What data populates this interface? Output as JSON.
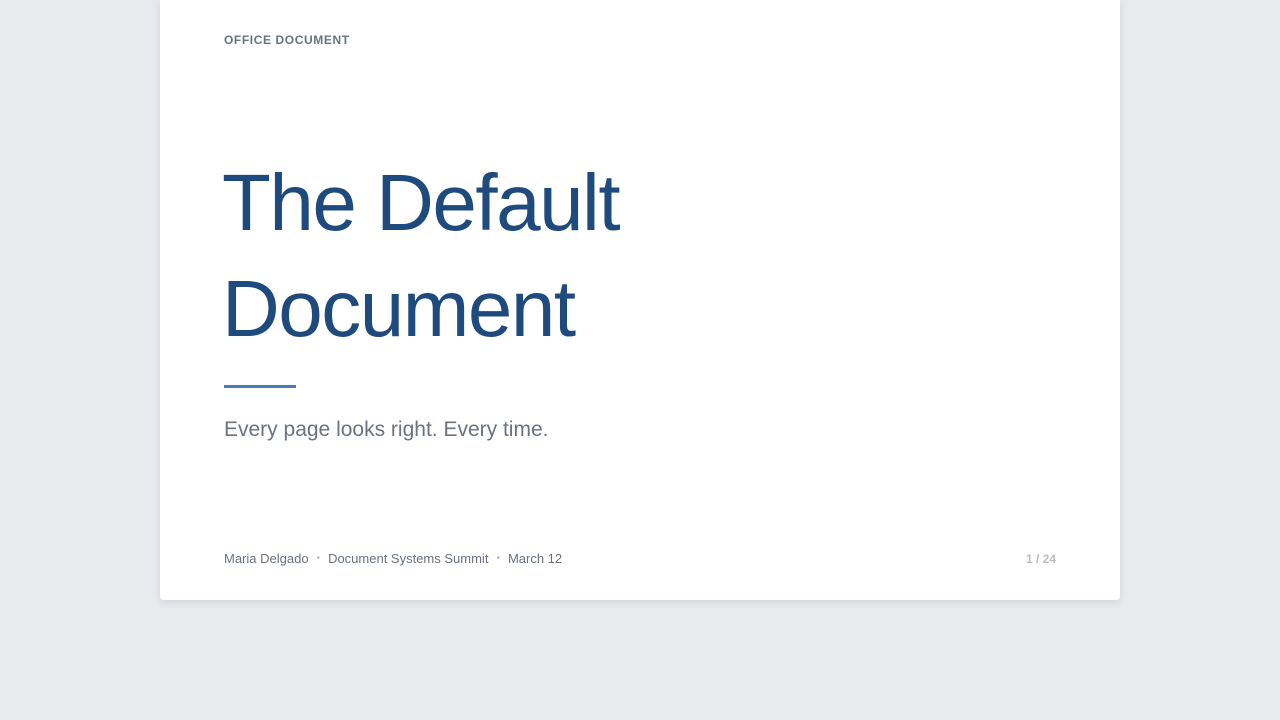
{
  "slide": {
    "eyebrow": "OFFICE DOCUMENT",
    "title_line1": "The Default",
    "title_line2": "Document",
    "subtitle": "Every page looks right. Every time.",
    "footer": {
      "author": "Maria Delgado",
      "event": "Document Systems Summit",
      "date": "March 12",
      "separator": "•"
    },
    "page_number": "1 / 24"
  },
  "colors": {
    "background": "#e8eaee",
    "title": "#1f4a7e",
    "accent_rule": "#4a7ab8",
    "muted_text": "#6b7280"
  }
}
